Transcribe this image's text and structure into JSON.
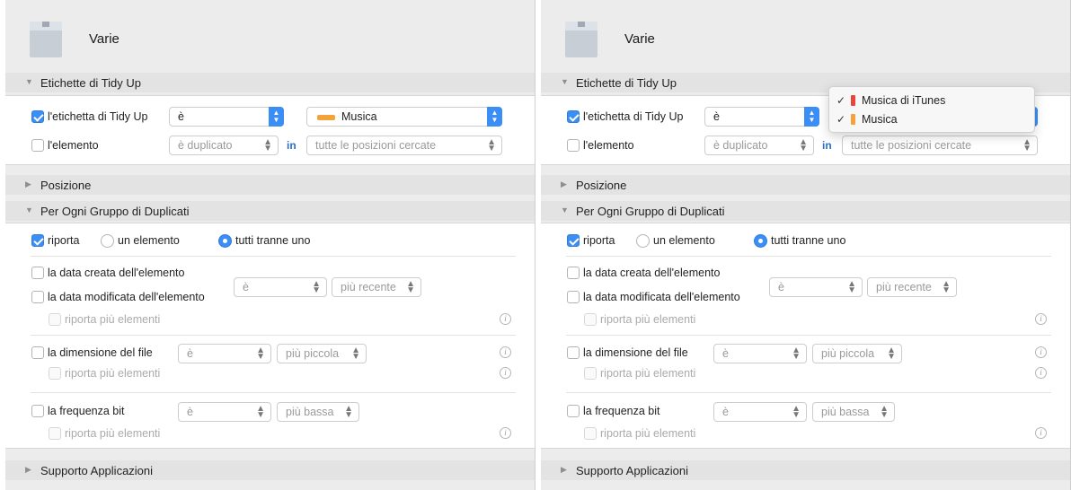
{
  "title": "Varie",
  "sections": {
    "tags": "Etichette di Tidy Up",
    "position": "Posizione",
    "group": "Per Ogni Gruppo di Duplicati",
    "support": "Supporto Applicazioni"
  },
  "tag_rule": {
    "label": "l'etichetta di Tidy Up",
    "operator": "è",
    "value": "Musica",
    "value_color": "#f3a33a"
  },
  "element_rule": {
    "label": "l'elemento",
    "operator": "è duplicato",
    "in_label": "in",
    "scope": "tutte le posizioni cercate"
  },
  "report": {
    "label": "riporta",
    "option_one": "un elemento",
    "option_all": "tutti tranne uno"
  },
  "date_rule": {
    "created_label": "la data creata dell'elemento",
    "modified_label": "la data modificata dell'elemento",
    "operator": "è",
    "value": "più recente",
    "multi_label": "riporta più elementi"
  },
  "size_rule": {
    "label": "la dimensione del file",
    "operator": "è",
    "value": "più piccola",
    "multi_label": "riporta più elementi"
  },
  "bitrate_rule": {
    "label": "la frequenza bit",
    "operator": "è",
    "value": "più bassa",
    "multi_label": "riporta più elementi"
  },
  "icons": {
    "info": "i",
    "check": "✓",
    "disclosure_open": "▼",
    "disclosure_closed": "▶",
    "popup_arrows": "⌃⌄"
  },
  "menu": {
    "items": [
      {
        "label": "Musica di iTunes",
        "color": "#e8453c",
        "checked": true
      },
      {
        "label": "Musica",
        "color": "#f3a33a",
        "checked": true
      }
    ]
  }
}
